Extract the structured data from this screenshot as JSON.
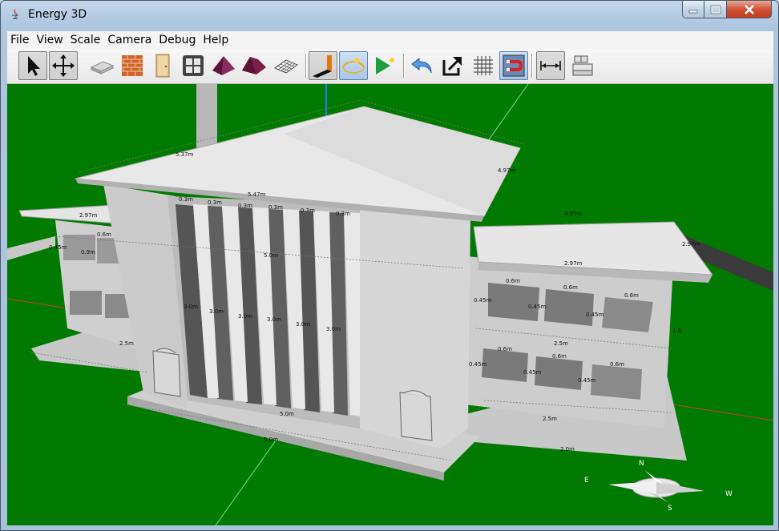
{
  "window": {
    "title": "Energy 3D"
  },
  "menu": {
    "items": [
      "File",
      "View",
      "Scale",
      "Camera",
      "Debug",
      "Help"
    ]
  },
  "toolbar": {
    "tools": [
      "select-arrow-icon",
      "resize-move-icon",
      "foundation-icon",
      "wall-icon",
      "door-icon",
      "window-icon",
      "hip-roof-icon",
      "custom-roof-icon",
      "floor-grid-icon",
      "heliodon-icon",
      "sun-path-icon",
      "run-play-icon",
      "undo-icon",
      "zoom-export-icon",
      "grid-icon",
      "snap-magnet-icon",
      "annotation-icon",
      "building-stack-icon"
    ]
  },
  "scene": {
    "ground_color": "#007a00",
    "annotations": {
      "roof_top": "5.47m",
      "roof_side": "4.97m",
      "roof_left_top": "5.37m",
      "left_roof": "2.97m",
      "right_roof_top": "4.97m",
      "right_roof": "2.97m",
      "right_roof_edge": "2.97m",
      "mid_beam": "5.0m",
      "mullion_labels": [
        "0.3m",
        "0.3m",
        "0.3m",
        "0.3m",
        "0.3m",
        "0.3m"
      ],
      "heights": [
        "3.0m",
        "3.0m",
        "3.0m",
        "3.0m",
        "3.0m",
        "3.0m"
      ],
      "base_front": "5.0m",
      "base_bottom": "5.0m",
      "left_wall_w": "2.5m",
      "left_win_1": "0.6m",
      "left_win_2": "0.9m",
      "left_win_3": "0.45m",
      "right_win_w": [
        "0.6m",
        "0.6m",
        "0.6m",
        "0.6m",
        "0.6m",
        "0.6m"
      ],
      "right_win_h": [
        "0.45m",
        "0.45m",
        "0.45m",
        "0.45m",
        "0.45m",
        "0.45m"
      ],
      "right_wall_w": "2.5m",
      "right_base": "2.5m",
      "right_base2": "2.0m",
      "right_side": "1.6",
      "compass": {
        "n": "N",
        "s": "S",
        "e": "E",
        "w": "W"
      }
    }
  }
}
